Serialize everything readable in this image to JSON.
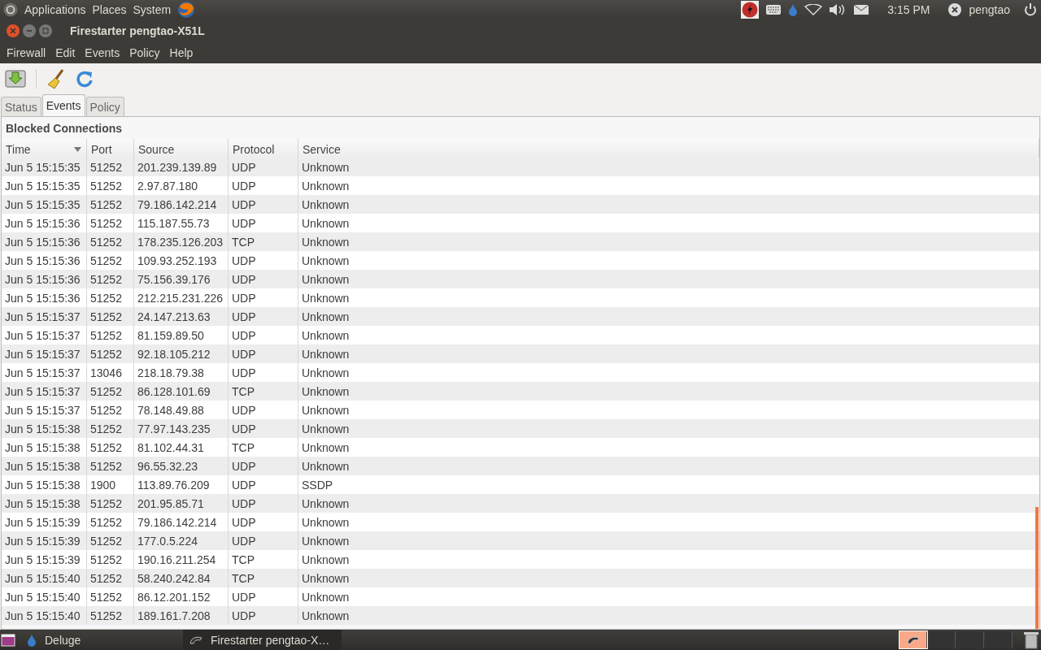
{
  "top_panel": {
    "menus": [
      "Applications",
      "Places",
      "System"
    ],
    "clock": "3:15 PM",
    "user": "pengtao"
  },
  "window": {
    "title": "Firestarter pengtao-X51L"
  },
  "menubar": [
    "Firewall",
    "Edit",
    "Events",
    "Policy",
    "Help"
  ],
  "tabs": [
    {
      "label": "Status",
      "selected": false
    },
    {
      "label": "Events",
      "selected": true
    },
    {
      "label": "Policy",
      "selected": false
    }
  ],
  "section_title": "Blocked Connections",
  "table": {
    "columns": [
      "Time",
      "Port",
      "Source",
      "Protocol",
      "Service"
    ],
    "rows": [
      [
        "Jun  5 15:15:35",
        "51252",
        "201.239.139.89",
        "UDP",
        "Unknown"
      ],
      [
        "Jun  5 15:15:35",
        "51252",
        "2.97.87.180",
        "UDP",
        "Unknown"
      ],
      [
        "Jun  5 15:15:35",
        "51252",
        "79.186.142.214",
        "UDP",
        "Unknown"
      ],
      [
        "Jun  5 15:15:36",
        "51252",
        "115.187.55.73",
        "UDP",
        "Unknown"
      ],
      [
        "Jun  5 15:15:36",
        "51252",
        "178.235.126.203",
        "TCP",
        "Unknown"
      ],
      [
        "Jun  5 15:15:36",
        "51252",
        "109.93.252.193",
        "UDP",
        "Unknown"
      ],
      [
        "Jun  5 15:15:36",
        "51252",
        "75.156.39.176",
        "UDP",
        "Unknown"
      ],
      [
        "Jun  5 15:15:36",
        "51252",
        "212.215.231.226",
        "UDP",
        "Unknown"
      ],
      [
        "Jun  5 15:15:37",
        "51252",
        "24.147.213.63",
        "UDP",
        "Unknown"
      ],
      [
        "Jun  5 15:15:37",
        "51252",
        "81.159.89.50",
        "UDP",
        "Unknown"
      ],
      [
        "Jun  5 15:15:37",
        "51252",
        "92.18.105.212",
        "UDP",
        "Unknown"
      ],
      [
        "Jun  5 15:15:37",
        "13046",
        "218.18.79.38",
        "UDP",
        "Unknown"
      ],
      [
        "Jun  5 15:15:37",
        "51252",
        "86.128.101.69",
        "TCP",
        "Unknown"
      ],
      [
        "Jun  5 15:15:37",
        "51252",
        "78.148.49.88",
        "UDP",
        "Unknown"
      ],
      [
        "Jun  5 15:15:38",
        "51252",
        "77.97.143.235",
        "UDP",
        "Unknown"
      ],
      [
        "Jun  5 15:15:38",
        "51252",
        "81.102.44.31",
        "TCP",
        "Unknown"
      ],
      [
        "Jun  5 15:15:38",
        "51252",
        "96.55.32.23",
        "UDP",
        "Unknown"
      ],
      [
        "Jun  5 15:15:38",
        "1900",
        "113.89.76.209",
        "UDP",
        "SSDP"
      ],
      [
        "Jun  5 15:15:38",
        "51252",
        "201.95.85.71",
        "UDP",
        "Unknown"
      ],
      [
        "Jun  5 15:15:39",
        "51252",
        "79.186.142.214",
        "UDP",
        "Unknown"
      ],
      [
        "Jun  5 15:15:39",
        "51252",
        "177.0.5.224",
        "UDP",
        "Unknown"
      ],
      [
        "Jun  5 15:15:39",
        "51252",
        "190.16.211.254",
        "TCP",
        "Unknown"
      ],
      [
        "Jun  5 15:15:40",
        "51252",
        "58.240.242.84",
        "TCP",
        "Unknown"
      ],
      [
        "Jun  5 15:15:40",
        "51252",
        "86.12.201.152",
        "UDP",
        "Unknown"
      ],
      [
        "Jun  5 15:15:40",
        "51252",
        "189.161.7.208",
        "UDP",
        "Unknown"
      ]
    ]
  },
  "taskbar": [
    {
      "label": "Deluge",
      "selected": false
    },
    {
      "label": "Firestarter pengtao-X…",
      "selected": true
    }
  ],
  "workspaces": [
    {
      "selected": true
    },
    {
      "selected": false
    },
    {
      "selected": false
    },
    {
      "selected": false
    }
  ]
}
